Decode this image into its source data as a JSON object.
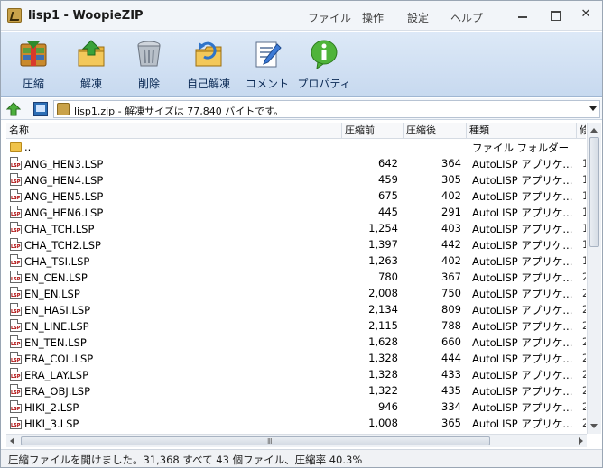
{
  "window": {
    "title": "lisp1 - WoopieZIP",
    "menu": [
      "ファイル",
      "操作",
      "設定",
      "ヘルプ"
    ]
  },
  "toolbar": {
    "buttons": [
      {
        "label": "圧縮",
        "icon": "compress-icon"
      },
      {
        "label": "解凍",
        "icon": "extract-icon"
      },
      {
        "label": "削除",
        "icon": "delete-icon"
      },
      {
        "label": "自己解凍",
        "icon": "self-extract-icon"
      },
      {
        "label": "コメント",
        "icon": "comment-icon"
      },
      {
        "label": "プロパティ",
        "icon": "properties-icon"
      }
    ]
  },
  "addressbar": {
    "text": "lisp1.zip - 解凍サイズは 77,840 バイトです。"
  },
  "list": {
    "columns": [
      "名称",
      "圧縮前",
      "圧縮後",
      "種類",
      "修"
    ],
    "rows": [
      {
        "name": "..",
        "before": "",
        "after": "",
        "type": "ファイル フォルダー",
        "extra": "",
        "icon": "folder"
      },
      {
        "name": "ANG_HEN3.LSP",
        "before": "642",
        "after": "364",
        "type": "AutoLISP アプリケ...",
        "extra": "1",
        "icon": "lsp"
      },
      {
        "name": "ANG_HEN4.LSP",
        "before": "459",
        "after": "305",
        "type": "AutoLISP アプリケ...",
        "extra": "1",
        "icon": "lsp"
      },
      {
        "name": "ANG_HEN5.LSP",
        "before": "675",
        "after": "402",
        "type": "AutoLISP アプリケ...",
        "extra": "1",
        "icon": "lsp"
      },
      {
        "name": "ANG_HEN6.LSP",
        "before": "445",
        "after": "291",
        "type": "AutoLISP アプリケ...",
        "extra": "1",
        "icon": "lsp"
      },
      {
        "name": "CHA_TCH.LSP",
        "before": "1,254",
        "after": "403",
        "type": "AutoLISP アプリケ...",
        "extra": "1",
        "icon": "lsp"
      },
      {
        "name": "CHA_TCH2.LSP",
        "before": "1,397",
        "after": "442",
        "type": "AutoLISP アプリケ...",
        "extra": "1",
        "icon": "lsp"
      },
      {
        "name": "CHA_TSI.LSP",
        "before": "1,263",
        "after": "402",
        "type": "AutoLISP アプリケ...",
        "extra": "1",
        "icon": "lsp"
      },
      {
        "name": "EN_CEN.LSP",
        "before": "780",
        "after": "367",
        "type": "AutoLISP アプリケ...",
        "extra": "2",
        "icon": "lsp"
      },
      {
        "name": "EN_EN.LSP",
        "before": "2,008",
        "after": "750",
        "type": "AutoLISP アプリケ...",
        "extra": "2",
        "icon": "lsp"
      },
      {
        "name": "EN_HASI.LSP",
        "before": "2,134",
        "after": "809",
        "type": "AutoLISP アプリケ...",
        "extra": "2",
        "icon": "lsp"
      },
      {
        "name": "EN_LINE.LSP",
        "before": "2,115",
        "after": "788",
        "type": "AutoLISP アプリケ...",
        "extra": "2",
        "icon": "lsp"
      },
      {
        "name": "EN_TEN.LSP",
        "before": "1,628",
        "after": "660",
        "type": "AutoLISP アプリケ...",
        "extra": "2",
        "icon": "lsp"
      },
      {
        "name": "ERA_COL.LSP",
        "before": "1,328",
        "after": "444",
        "type": "AutoLISP アプリケ...",
        "extra": "2",
        "icon": "lsp"
      },
      {
        "name": "ERA_LAY.LSP",
        "before": "1,328",
        "after": "433",
        "type": "AutoLISP アプリケ...",
        "extra": "2",
        "icon": "lsp"
      },
      {
        "name": "ERA_OBJ.LSP",
        "before": "1,322",
        "after": "435",
        "type": "AutoLISP アプリケ...",
        "extra": "2",
        "icon": "lsp"
      },
      {
        "name": "HIKI_2.LSP",
        "before": "946",
        "after": "334",
        "type": "AutoLISP アプリケ...",
        "extra": "2",
        "icon": "lsp"
      },
      {
        "name": "HIKI_3.LSP",
        "before": "1,008",
        "after": "365",
        "type": "AutoLISP アプリケ...",
        "extra": "2",
        "icon": "lsp"
      }
    ]
  },
  "hscroll": {
    "grip": "Ⅲ"
  },
  "status": {
    "text": "圧縮ファイルを開けました。31,368 すべて 43 個ファイル、圧縮率 40.3%"
  }
}
